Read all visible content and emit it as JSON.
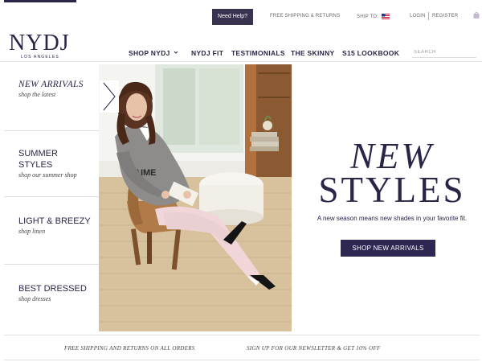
{
  "utility": {
    "need_help": "Need Help?",
    "free_shipping": "FREE SHIPPING & RETURNS",
    "ship_to": "SHIP TO:",
    "login": "LOGIN",
    "register": "REGISTER"
  },
  "brand": {
    "logo": "NYDJ",
    "tagline": "LOS ANGELES"
  },
  "nav": {
    "items": [
      "SHOP NYDJ",
      "NYDJ FIT",
      "TESTIMONIALS",
      "THE SKINNY",
      "S15 LOOKBOOK"
    ],
    "search_placeholder": "SEARCH"
  },
  "side": {
    "items": [
      {
        "title": "NEW ARRIVALS",
        "subtitle": "shop the latest"
      },
      {
        "title": "SUMMER STYLES",
        "title_line2": "STYLES",
        "title_line1": "SUMMER",
        "subtitle": "shop our summer shop"
      },
      {
        "title": "LIGHT & BREEZY",
        "subtitle": "shop linen"
      },
      {
        "title": "BEST DRESSED",
        "subtitle": "shop dresses"
      }
    ]
  },
  "hero_shirt_text": "AIME",
  "promo": {
    "line1": "NEW",
    "line2": "STYLES",
    "subtitle": "A new season means new shades in your favorite fit.",
    "cta": "SHOP NEW ARRIVALS"
  },
  "footer": {
    "left": "FREE SHIPPING AND RETURNS ON ALL ORDERS",
    "right": "SIGN UP FOR OUR NEWSLETTER & GET 10% OFF"
  },
  "colors": {
    "brand": "#2b2447",
    "button": "#2e2751"
  }
}
